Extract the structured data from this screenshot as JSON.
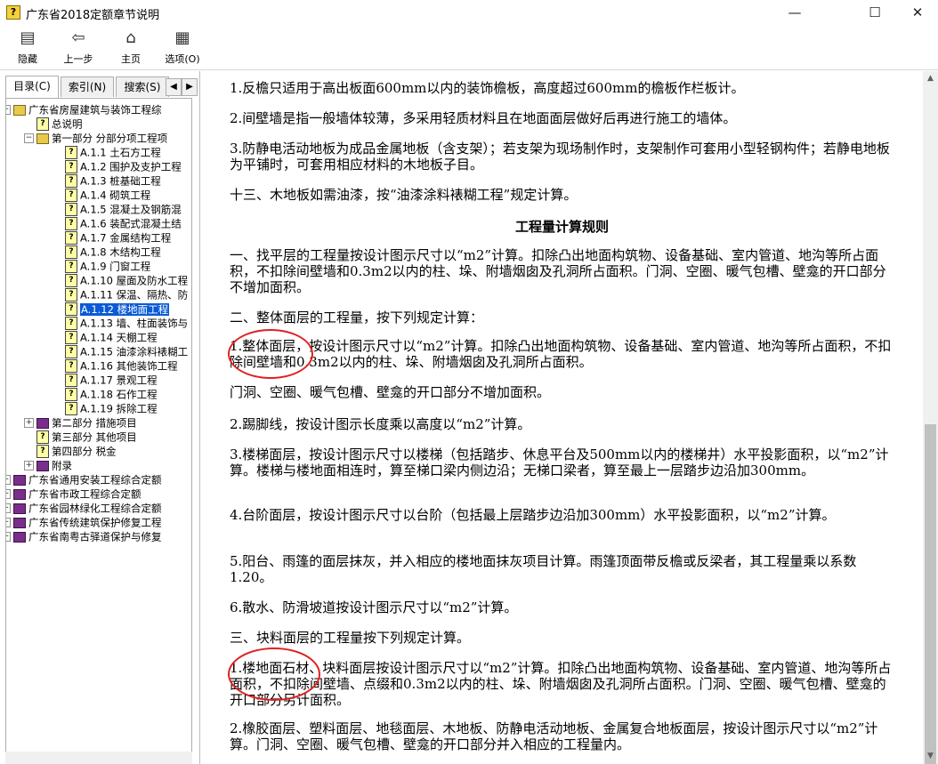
{
  "window": {
    "title": "广东省2018定额章节说明",
    "minimize": "—",
    "maximize": "☐",
    "close": "✕"
  },
  "toolbar": [
    {
      "label": "隐藏",
      "icon": "hide-icon"
    },
    {
      "label": "上一步",
      "icon": "back-arrow-icon"
    },
    {
      "label": "主页",
      "icon": "home-icon"
    },
    {
      "label": "选项(O)",
      "icon": "options-icon"
    }
  ],
  "tabs": [
    {
      "label": "目录(C)"
    },
    {
      "label": "索引(N)"
    },
    {
      "label": "搜索(S)"
    }
  ],
  "tree": [
    {
      "text": "广东省房屋建筑与装饰工程综",
      "level": 0,
      "type": "open",
      "exp": "⊟"
    },
    {
      "text": "总说明",
      "level": 1,
      "type": "page"
    },
    {
      "text": "第一部分 分部分项工程项",
      "level": 1,
      "type": "open",
      "exp": "⊟"
    },
    {
      "text": "A.1.1 土石方工程",
      "level": 2,
      "type": "page"
    },
    {
      "text": "A.1.2 围护及支护工程",
      "level": 2,
      "type": "page"
    },
    {
      "text": "A.1.3 桩基础工程",
      "level": 2,
      "type": "page"
    },
    {
      "text": "A.1.4 砌筑工程",
      "level": 2,
      "type": "page"
    },
    {
      "text": "A.1.5 混凝土及钢筋混",
      "level": 2,
      "type": "page"
    },
    {
      "text": "A.1.6 装配式混凝土结",
      "level": 2,
      "type": "page"
    },
    {
      "text": "A.1.7 金属结构工程",
      "level": 2,
      "type": "page"
    },
    {
      "text": "A.1.8 木结构工程",
      "level": 2,
      "type": "page"
    },
    {
      "text": "A.1.9 门窗工程",
      "level": 2,
      "type": "page"
    },
    {
      "text": "A.1.10 屋面及防水工程",
      "level": 2,
      "type": "page"
    },
    {
      "text": "A.1.11 保温、隔热、防",
      "level": 2,
      "type": "page"
    },
    {
      "text": "A.1.12 楼地面工程",
      "level": 2,
      "type": "page",
      "selected": true
    },
    {
      "text": "A.1.13 墙、柱面装饰与",
      "level": 2,
      "type": "page"
    },
    {
      "text": "A.1.14 天棚工程",
      "level": 2,
      "type": "page"
    },
    {
      "text": "A.1.15 油漆涂料裱糊工",
      "level": 2,
      "type": "page"
    },
    {
      "text": "A.1.16 其他装饰工程",
      "level": 2,
      "type": "page"
    },
    {
      "text": "A.1.17 景观工程",
      "level": 2,
      "type": "page"
    },
    {
      "text": "A.1.18 石作工程",
      "level": 2,
      "type": "page"
    },
    {
      "text": "A.1.19 拆除工程",
      "level": 2,
      "type": "page"
    },
    {
      "text": "第二部分 措施项目",
      "level": 1,
      "type": "closed",
      "exp": "⊞"
    },
    {
      "text": "第三部分 其他项目",
      "level": 1,
      "type": "page"
    },
    {
      "text": "第四部分 税金",
      "level": 1,
      "type": "page"
    },
    {
      "text": "附录",
      "level": 1,
      "type": "closed",
      "exp": "⊞"
    },
    {
      "text": "广东省通用安装工程综合定额",
      "level": 0,
      "type": "closed",
      "exp": "⊞"
    },
    {
      "text": "广东省市政工程综合定额",
      "level": 0,
      "type": "closed",
      "exp": "⊞"
    },
    {
      "text": "广东省园林绿化工程综合定额",
      "level": 0,
      "type": "closed",
      "exp": "⊞"
    },
    {
      "text": "广东省传统建筑保护修复工程",
      "level": 0,
      "type": "closed",
      "exp": "⊞"
    },
    {
      "text": "广东省南粤古驿道保护与修复",
      "level": 0,
      "type": "closed",
      "exp": "⊞"
    }
  ],
  "content": {
    "heading": "工程量计算规则",
    "paragraphs": [
      "1.反檐只适用于高出板面600mm以内的装饰檐板，高度超过600mm的檐板作栏板计。",
      "2.间壁墙是指一般墙体较薄，多采用轻质材料且在地面面层做好后再进行施工的墙体。",
      "3.防静电活动地板为成品金属地板（含支架）；若支架为现场制作时，支架制作可套用小型轻钢构件；若静电地板为平铺时，可套用相应材料的木地板子目。",
      "十三、木地板如需油漆，按“油漆涂料裱糊工程”规定计算。",
      "一、找平层的工程量按设计图示尺寸以“m2”计算。扣除凸出地面构筑物、设备基础、室内管道、地沟等所占面积，不扣除间壁墙和0.3m2以内的柱、垛、附墙烟囱及孔洞所占面积。门洞、空圈、暖气包槽、壁龛的开口部分不增加面积。",
      "二、整体面层的工程量，按下列规定计算：",
      "1.整体面层，按设计图示尺寸以“m2”计算。扣除凸出地面构筑物、设备基础、室内管道、地沟等所占面积，不扣除间壁墙和0.3m2以内的柱、垛、附墙烟囱及孔洞所占面积。",
      "门洞、空圈、暖气包槽、壁龛的开口部分不增加面积。",
      "2.踢脚线，按设计图示长度乘以高度以“m2”计算。",
      "3.楼梯面层，按设计图示尺寸以楼梯（包括踏步、休息平台及500mm以内的楼梯井）水平投影面积，以“m2”计算。楼梯与楼地面相连时，算至梯口梁内侧边沿；无梯口梁者，算至最上一层踏步边沿加300mm。",
      "4.台阶面层，按设计图示尺寸以台阶（包括最上层踏步边沿加300mm）水平投影面积，以“m2”计算。",
      "5.阳台、雨篷的面层抹灰，并入相应的楼地面抹灰项目计算。雨篷顶面带反檐或反梁者，其工程量乘以系数1.20。",
      "6.散水、防滑坡道按设计图示尺寸以“m2”计算。",
      "三、块料面层的工程量按下列规定计算。",
      "1.楼地面石材、块料面层按设计图示尺寸以“m2”计算。扣除凸出地面构筑物、设备基础、室内管道、地沟等所占面积，不扣除间壁墙、点缀和0.3m2以内的柱、垛、附墙烟囱及孔洞所占面积。门洞、空圈、暖气包槽、壁龛的开口部分另计面积。",
      "2.橡胶面层、塑料面层、地毯面层、木地板、防静电活动地板、金属复合地板面层，按设计图示尺寸以“m2”计算。门洞、空圈、暖气包槽、壁龛的开口部分并入相应的工程量内。"
    ]
  }
}
